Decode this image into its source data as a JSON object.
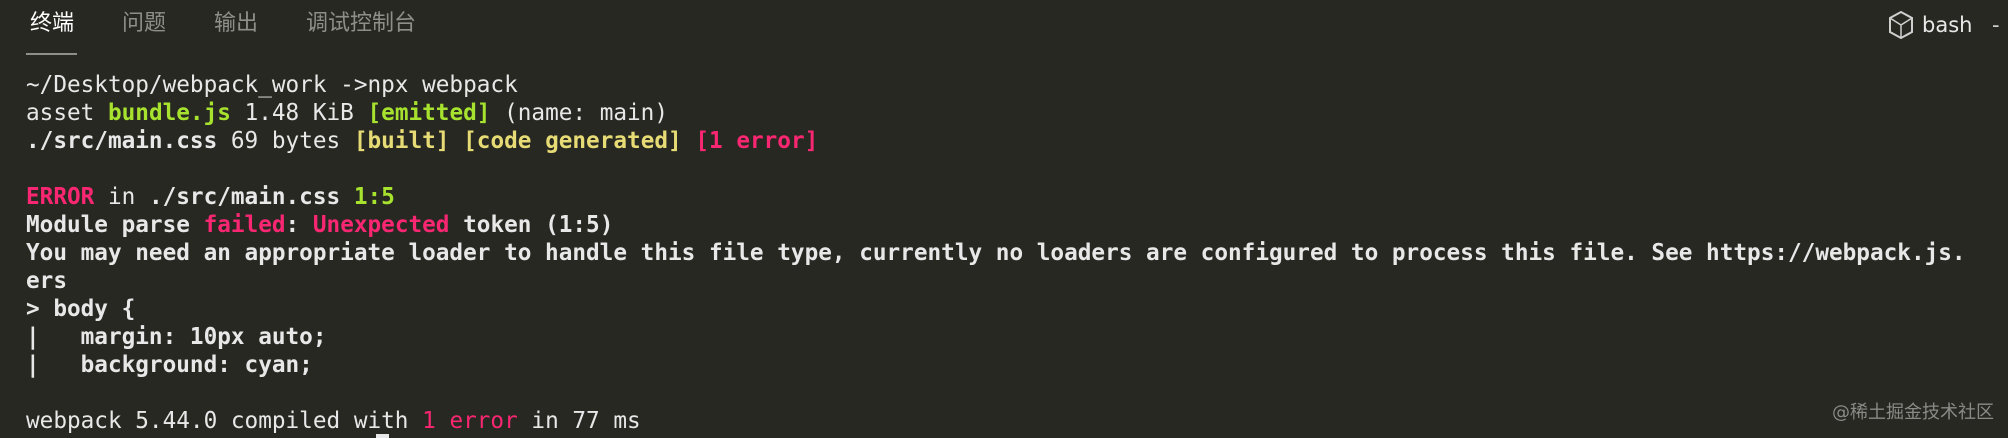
{
  "tabs": [
    {
      "label": "终端",
      "active": true
    },
    {
      "label": "问题",
      "active": false
    },
    {
      "label": "输出",
      "active": false
    },
    {
      "label": "调试控制台",
      "active": false
    }
  ],
  "shell": {
    "label": "bash",
    "icon": "terminal-icon",
    "trailing": "-"
  },
  "colors": {
    "background": "#272822",
    "text": "#e8e8e8",
    "green": "#a6e22e",
    "yellow": "#e6db74",
    "red": "#f92672"
  },
  "terminal": {
    "line1": {
      "text": "~/Desktop/webpack_work ->npx webpack"
    },
    "line2": {
      "t1": "asset ",
      "t2": "bundle.js",
      "t3": " 1.48 KiB ",
      "t4": "[emitted]",
      "t5": " (name: main)"
    },
    "line3": {
      "t1": "./src/main.css",
      "t2": " 69 bytes ",
      "t3": "[built]",
      "t4": " ",
      "t5": "[code generated]",
      "t6": " ",
      "t7": "[1 error]"
    },
    "line5": {
      "t1": "ERROR",
      "t2": " in ",
      "t3": "./src/main.css",
      "t4": " ",
      "t5": "1:5"
    },
    "line6": {
      "t1": "Module parse ",
      "t2": "failed",
      "t3": ": ",
      "t4": "Unexpected",
      "t5": " token (1:5)"
    },
    "line7": {
      "text": "You may need an appropriate loader to handle this file type, currently no loaders are configured to process this file. See https://webpack.js."
    },
    "line8": {
      "text": "ers"
    },
    "line9": {
      "text": "> body {"
    },
    "line10": {
      "text": "|   margin: 10px auto;"
    },
    "line11": {
      "text": "|   background: cyan;"
    },
    "line13": {
      "t1": "webpack 5.44.0 compiled with ",
      "t2": "1 error",
      "t3": " in 77 ms"
    }
  },
  "watermark": "@稀土掘金技术社区"
}
